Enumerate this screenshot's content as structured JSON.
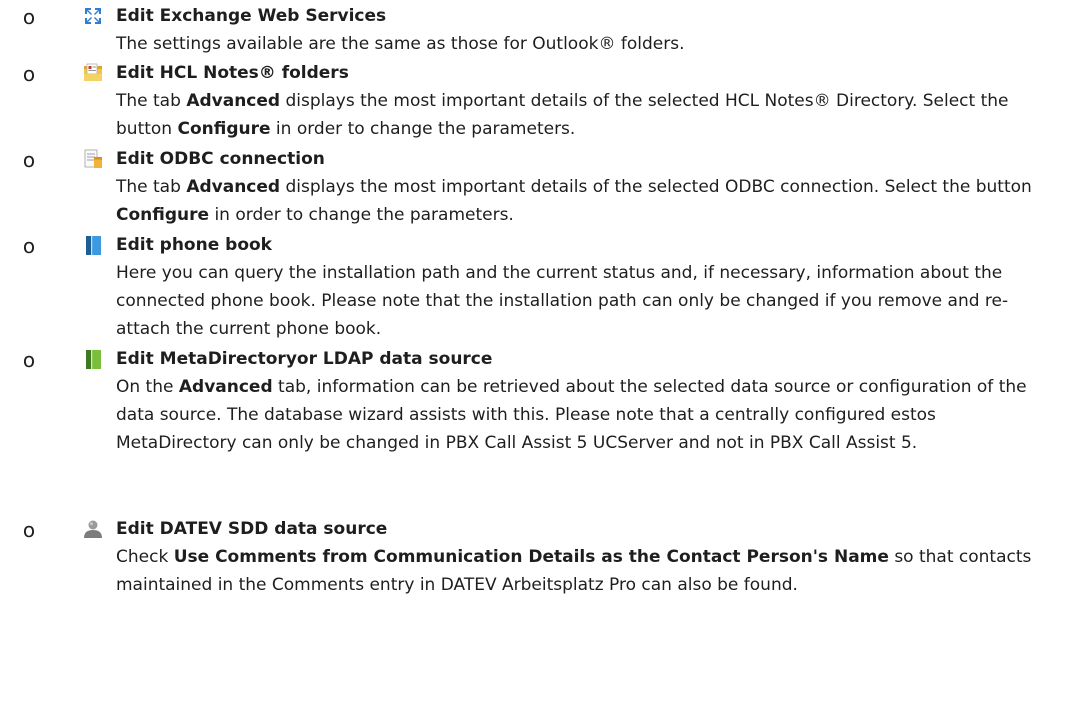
{
  "bullet_glyph": "o",
  "items": [
    {
      "icon": "exchange-icon",
      "heading": "Edit Exchange Web Services",
      "desc": [
        {
          "t": "The settings available are the same as those for Outlook® folders.",
          "b": false
        }
      ]
    },
    {
      "icon": "notes-folder-icon",
      "heading": "Edit HCL Notes® folders",
      "desc": [
        {
          "t": "The tab ",
          "b": false
        },
        {
          "t": "Advanced",
          "b": true
        },
        {
          "t": " displays the most important details of the selected HCL Notes® Directory. Select the button ",
          "b": false
        },
        {
          "t": "Configure",
          "b": true
        },
        {
          "t": " in order to change the parameters.",
          "b": false
        }
      ]
    },
    {
      "icon": "odbc-icon",
      "heading": "Edit ODBC connection",
      "desc": [
        {
          "t": "The tab ",
          "b": false
        },
        {
          "t": "Advanced",
          "b": true
        },
        {
          "t": " displays the most important details of the selected ODBC connection. Select the button ",
          "b": false
        },
        {
          "t": "Configure",
          "b": true
        },
        {
          "t": " in order to change the parameters.",
          "b": false
        }
      ]
    },
    {
      "icon": "phone-book-icon",
      "heading": "Edit phone book",
      "desc": [
        {
          "t": "Here you can query the installation path and the current status and, if necessary, information about the connected phone book. Please note that the installation path can only be changed if you remove and re-attach the current phone book.",
          "b": false
        }
      ]
    },
    {
      "icon": "metadirectory-icon",
      "heading": "Edit MetaDirectoryor LDAP data source",
      "desc": [
        {
          "t": "On the ",
          "b": false
        },
        {
          "t": "Advanced",
          "b": true
        },
        {
          "t": " tab, information can be retrieved about the selected data source or configuration of the data source. The database wizard assists with this. Please note that a centrally configured estos MetaDirectory can only be changed in PBX Call Assist 5 UCServer and not in PBX Call Assist 5.",
          "b": false
        }
      ]
    },
    {
      "icon": "datev-person-icon",
      "heading": "Edit DATEV SDD data source",
      "desc": [
        {
          "t": "Check ",
          "b": false
        },
        {
          "t": "Use Comments from Communication Details as the Contact Person's Name",
          "b": true
        },
        {
          "t": " so that contacts maintained in the Comments entry in DATEV Arbeitsplatz Pro can also be found.",
          "b": false
        }
      ]
    }
  ]
}
